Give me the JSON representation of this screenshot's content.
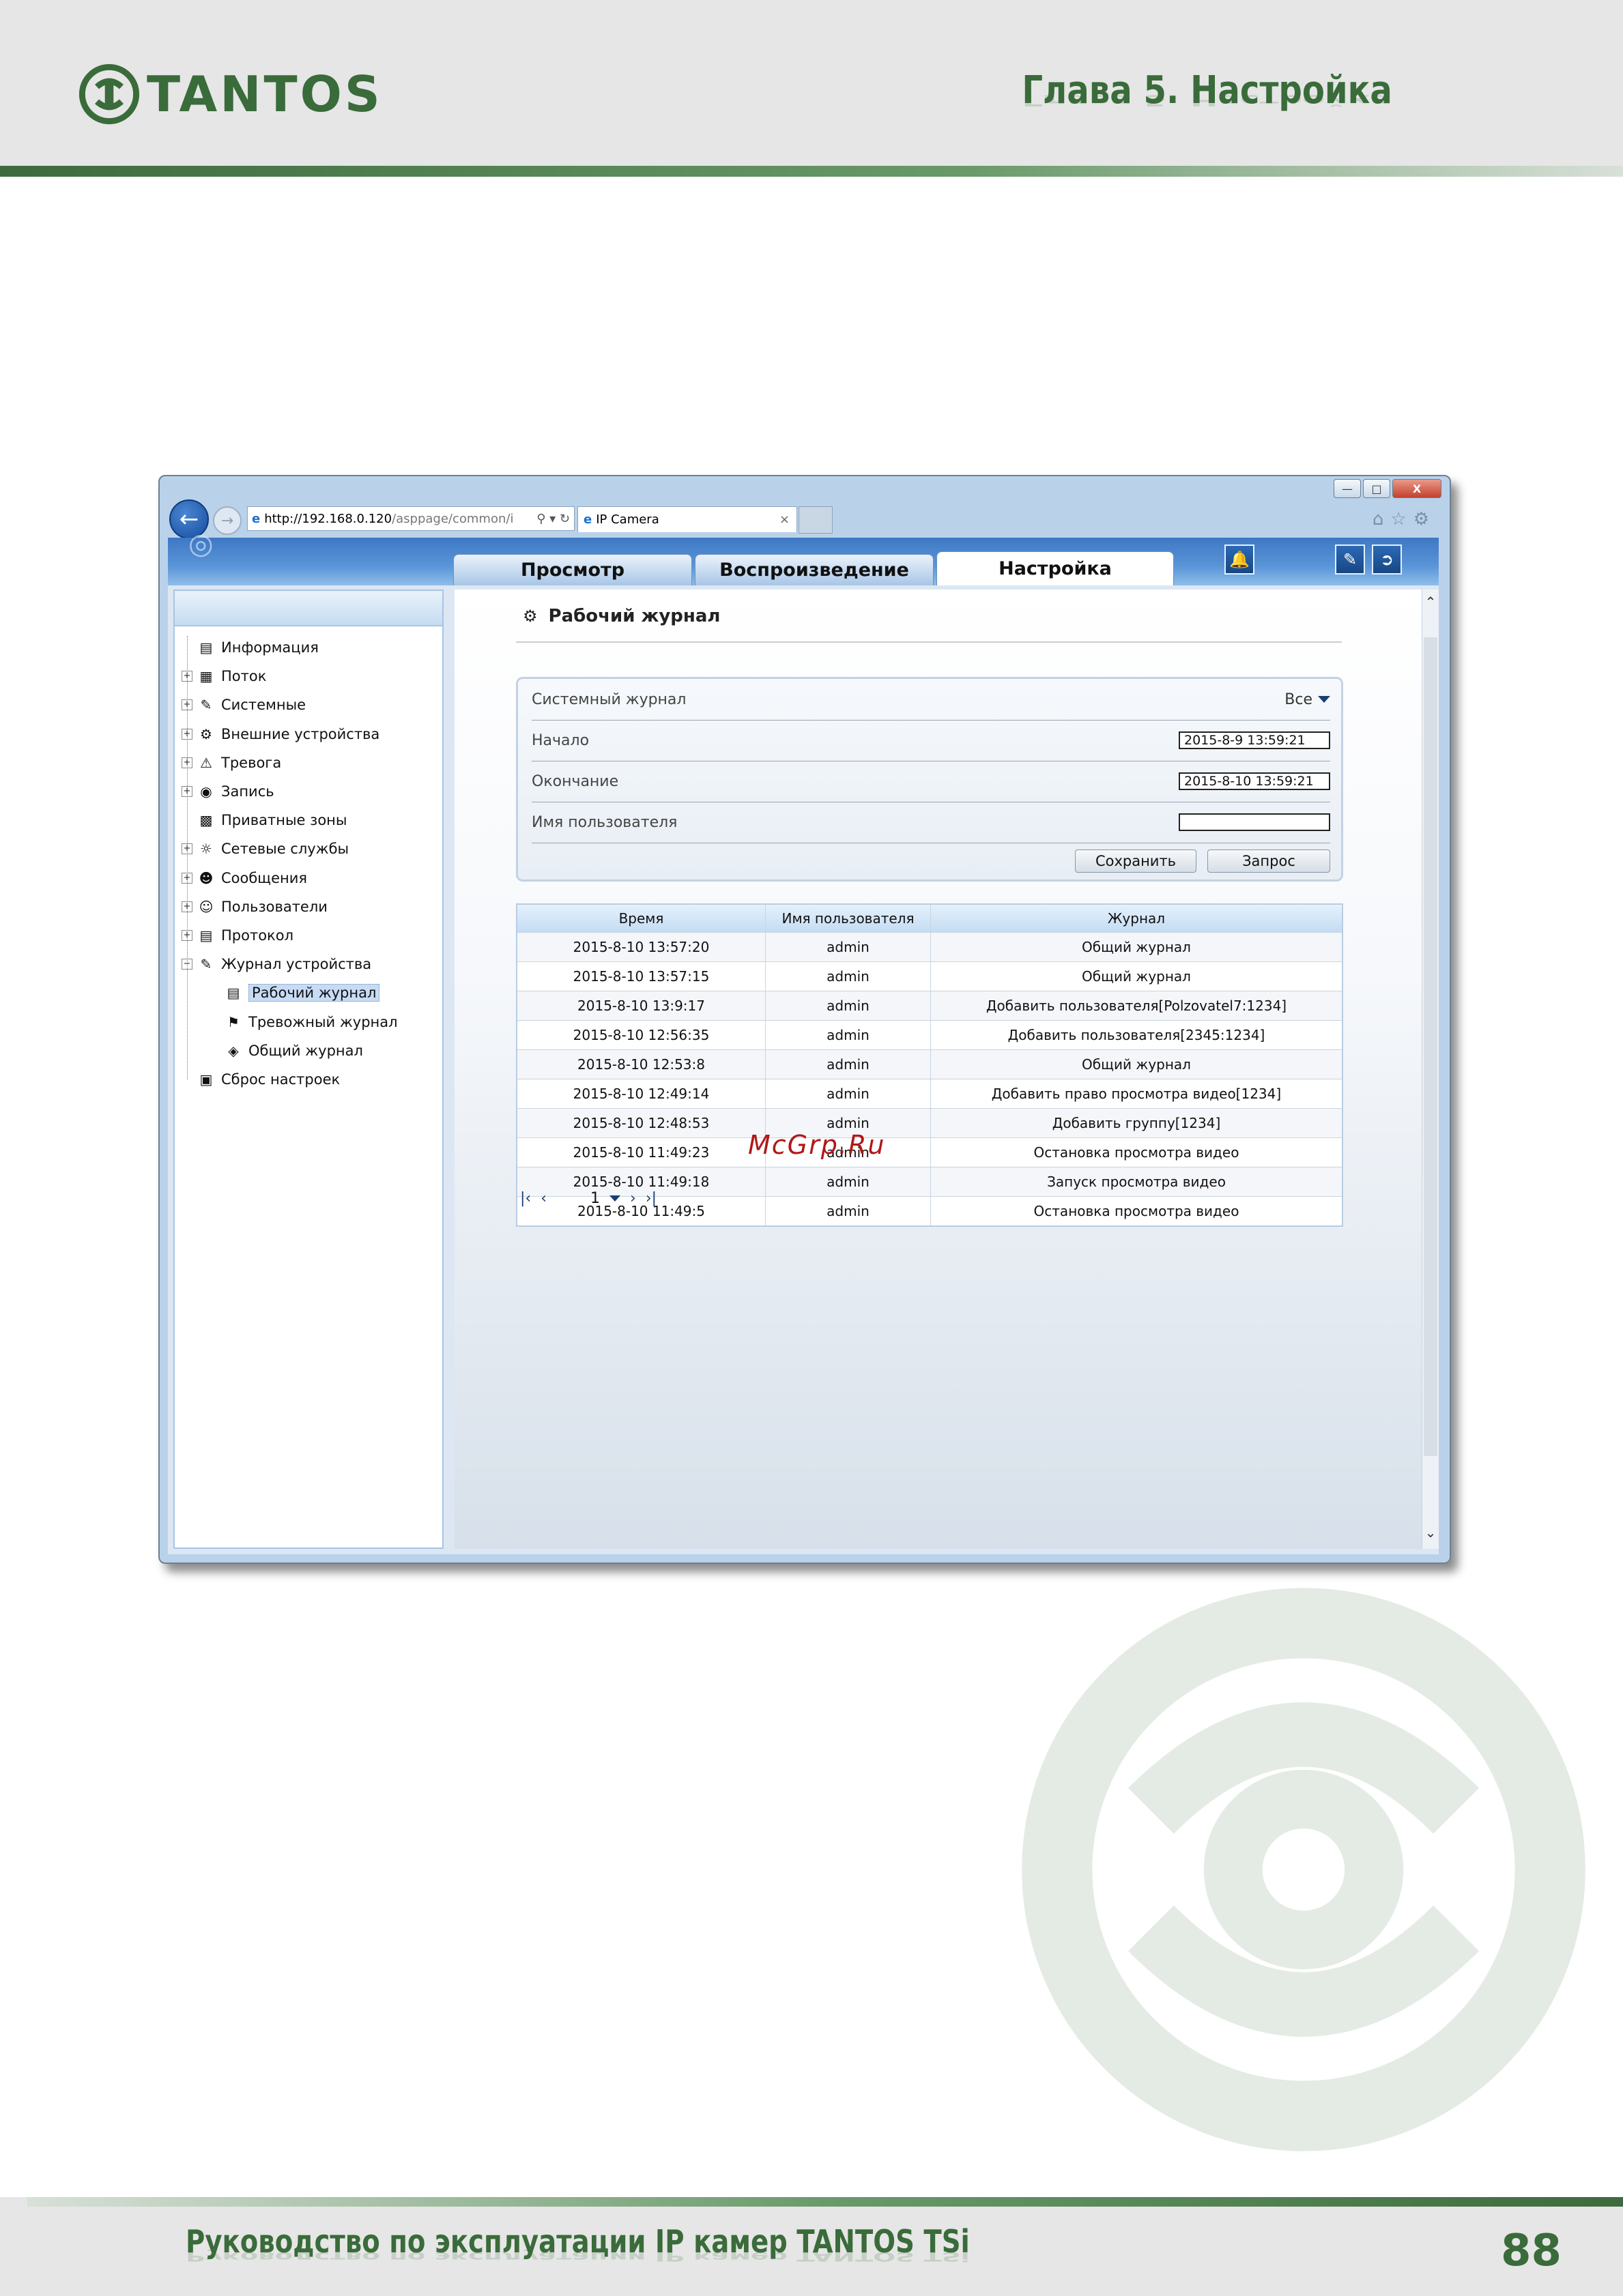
{
  "header": {
    "logo_text": "TANTOS",
    "chapter": "Глава 5. Настройка"
  },
  "footer": {
    "title": "Руководство по эксплуатации IP камер TANTOS TSi",
    "page_number": "88"
  },
  "browser": {
    "address_host": "http://192.168.0.120",
    "address_path": "/asppage/common/i",
    "tab_title": "IP Camera",
    "window_controls": [
      "—",
      "□",
      "X"
    ]
  },
  "app": {
    "tabs": [
      {
        "label": "Просмотр",
        "active": false
      },
      {
        "label": "Воспроизведение",
        "active": false
      },
      {
        "label": "Настройка",
        "active": true
      }
    ],
    "sidebar": {
      "items": [
        {
          "label": "Информация",
          "icon": "info-icon",
          "expandable": false,
          "level": 0
        },
        {
          "label": "Поток",
          "icon": "stream-icon",
          "expandable": true,
          "level": 0
        },
        {
          "label": "Системные",
          "icon": "system-icon",
          "expandable": true,
          "level": 0
        },
        {
          "label": "Внешние устройства",
          "icon": "external-devices-icon",
          "expandable": true,
          "level": 0
        },
        {
          "label": "Тревога",
          "icon": "alarm-icon",
          "expandable": true,
          "level": 0
        },
        {
          "label": "Запись",
          "icon": "record-icon",
          "expandable": true,
          "level": 0
        },
        {
          "label": "Приватные зоны",
          "icon": "privacy-icon",
          "expandable": false,
          "level": 0
        },
        {
          "label": "Сетевые службы",
          "icon": "network-icon",
          "expandable": true,
          "level": 0
        },
        {
          "label": "Сообщения",
          "icon": "messages-icon",
          "expandable": true,
          "level": 0
        },
        {
          "label": "Пользователи",
          "icon": "users-icon",
          "expandable": true,
          "level": 0
        },
        {
          "label": "Протокол",
          "icon": "protocol-icon",
          "expandable": true,
          "level": 0
        },
        {
          "label": "Журнал устройства",
          "icon": "device-log-icon",
          "expandable": true,
          "expanded": true,
          "level": 0
        },
        {
          "label": "Рабочий журнал",
          "icon": "work-log-icon",
          "expandable": false,
          "level": 1,
          "selected": true
        },
        {
          "label": "Тревожный журнал",
          "icon": "alarm-log-icon",
          "expandable": false,
          "level": 1
        },
        {
          "label": "Общий журнал",
          "icon": "general-log-icon",
          "expandable": false,
          "level": 1
        },
        {
          "label": "Сброс настроек",
          "icon": "reset-icon",
          "expandable": false,
          "level": 0
        }
      ]
    },
    "page_title": "Рабочий журнал",
    "form": {
      "type_label": "Системный журнал",
      "type_value": "Все",
      "start_label": "Начало",
      "start_value": "2015-8-9 13:59:21",
      "end_label": "Окончание",
      "end_value": "2015-8-10 13:59:21",
      "user_label": "Имя пользователя",
      "user_value": "",
      "save_label": "Сохранить",
      "query_label": "Запрос"
    },
    "table": {
      "headers": [
        "Время",
        "Имя пользователя",
        "Журнал"
      ],
      "rows": [
        [
          "2015-8-10 13:57:20",
          "admin",
          "Общий журнал"
        ],
        [
          "2015-8-10 13:57:15",
          "admin",
          "Общий журнал"
        ],
        [
          "2015-8-10 13:9:17",
          "admin",
          "Добавить пользователя[Polzovatel7:1234]"
        ],
        [
          "2015-8-10 12:56:35",
          "admin",
          "Добавить пользователя[2345:1234]"
        ],
        [
          "2015-8-10 12:53:8",
          "admin",
          "Общий журнал"
        ],
        [
          "2015-8-10 12:49:14",
          "admin",
          "Добавить право просмотра видео[1234]"
        ],
        [
          "2015-8-10 12:48:53",
          "admin",
          "Добавить группу[1234]"
        ],
        [
          "2015-8-10 11:49:23",
          "admin",
          "Остановка просмотра видео"
        ],
        [
          "2015-8-10 11:49:18",
          "admin",
          "Запуск просмотра видео"
        ],
        [
          "2015-8-10 11:49:5",
          "admin",
          "Остановка просмотра видео"
        ]
      ]
    },
    "pager": {
      "current_page": "1"
    }
  },
  "overlay_text": "McGrp.Ru"
}
